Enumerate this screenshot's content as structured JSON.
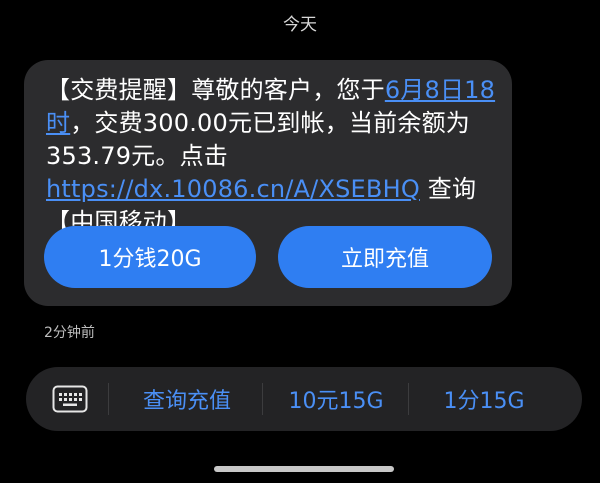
{
  "date_header": "今天",
  "message": {
    "part1": "【交费提醒】尊敬的客户，您于",
    "date_link": "6月8日18时",
    "part2": "，交费300.00元已到帐，当前余额为353.79元。点击 ",
    "url_link": "https://dx.10086.cn/A/XSEBHQ",
    "part3": " 查询【中国移动】"
  },
  "buttons": {
    "offer_label": "1分钱20G",
    "recharge_label": "立即充值"
  },
  "timestamp": "2分钟前",
  "quick_replies": [
    {
      "label": "查询充值"
    },
    {
      "label": "10元15G"
    },
    {
      "label": "1分15G"
    }
  ],
  "colors": {
    "accent": "#2f7ef2",
    "link": "#4a8ff5",
    "bubble": "#2c2c2e",
    "background": "#000000"
  },
  "icons": {
    "keyboard": "keyboard-icon"
  }
}
